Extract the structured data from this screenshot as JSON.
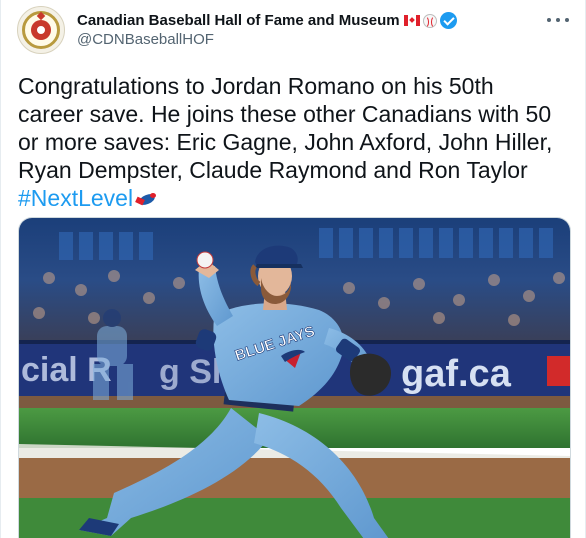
{
  "account": {
    "display_name": "Canadian Baseball Hall of Fame and Museum",
    "handle": "@CDNBaseballHOF",
    "avatar_icon": "hall-of-fame-logo",
    "emojis": [
      "canada-flag",
      "baseball"
    ],
    "verified": true
  },
  "tweet": {
    "text": "Congratulations to Jordan Romano on his 50th career save. He joins these other Canadians with 50 or more saves: Eric Gagne, John Axford, John Hiller, Ryan Dempster, Claude Raymond and Ron Taylor",
    "hashtag": "#NextLevel",
    "hashflag_icon": "blue-jays-logo"
  },
  "photo": {
    "jersey_text": "BLUE JAYS",
    "signage_left": "cial R",
    "signage_middle": "g Shin",
    "signage_right": "gaf.ca"
  },
  "colors": {
    "link": "#1d9bf0",
    "text": "#0f1419",
    "secondary": "#536471",
    "jays_blue": "#6fa8dc",
    "grass": "#3f8a3a",
    "dirt": "#9a6a45"
  }
}
